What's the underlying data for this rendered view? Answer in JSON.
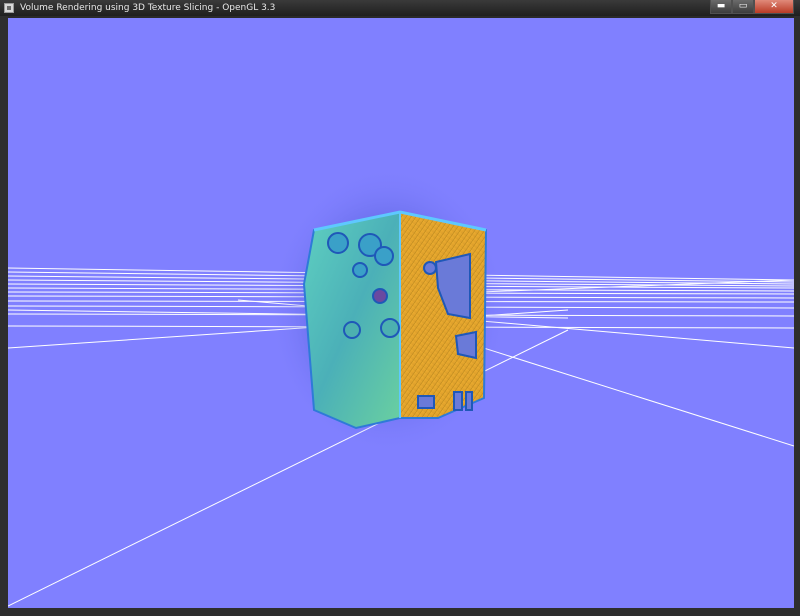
{
  "window": {
    "title": "Volume Rendering using 3D Texture Slicing - OpenGL 3.3",
    "minimize_glyph": "▬",
    "maximize_glyph": "▭",
    "close_glyph": "✕"
  },
  "scene": {
    "background_color": "#8080ff",
    "grid_color": "#ffffff",
    "volume_colors": {
      "face_front": "#4fbfb0",
      "face_side": "#e7a830",
      "halo": "#2e3fb0"
    }
  }
}
